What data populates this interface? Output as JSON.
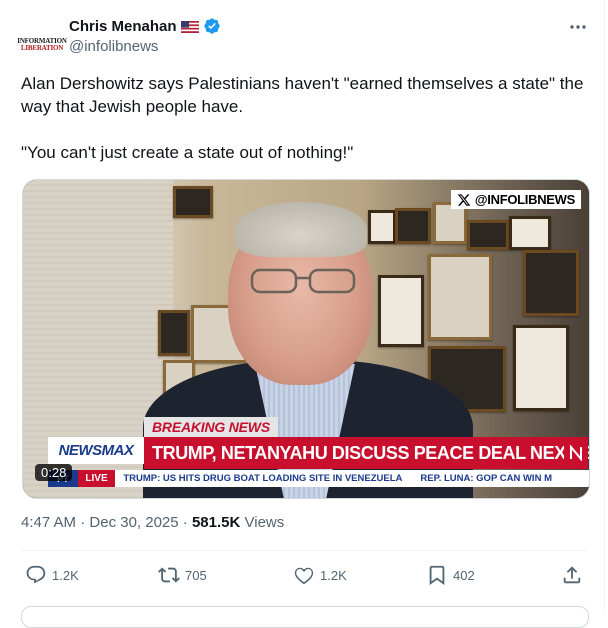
{
  "author": {
    "name": "Chris Menahan",
    "handle": "@infolibnews",
    "avatar_line1": "INFORMATION",
    "avatar_line2": "LIBERATION",
    "flag_icon": "us-flag-icon",
    "verified_icon": "verified-badge-icon"
  },
  "tweet": {
    "paragraph1": "Alan Dershowitz says Palestinians haven't \"earned themselves a state\" the way that Jewish people have.",
    "paragraph2": "\"You can't just create a state out of nothing!\""
  },
  "media": {
    "watermark": "@INFOLIBNEWS",
    "breaking_label": "BREAKING NEWS",
    "network": "NEWSMAX",
    "headline": "TRUMP, NETANYAHU DISCUSS PEACE DEAL NEXT STEPS",
    "timezone": "PT",
    "live_label": "LIVE",
    "ticker1": "TRUMP: US HITS DRUG BOAT LOADING SITE IN VENEZUELA",
    "ticker2": "REP. LUNA: GOP CAN WIN M",
    "duration": "0:28"
  },
  "meta": {
    "time": "4:47 AM",
    "sep": " · ",
    "date": "Dec 30, 2025",
    "sep2": " · ",
    "views_count": "581.5K",
    "views_label": " Views"
  },
  "actions": {
    "replies": "1.2K",
    "reposts": "705",
    "likes": "1.2K",
    "bookmarks": "402"
  },
  "colors": {
    "text": "#0f1419",
    "secondary": "#536471",
    "verified": "#1d9bf0",
    "newsmax_red": "#c8102e",
    "newsmax_blue": "#1b3a8c"
  }
}
